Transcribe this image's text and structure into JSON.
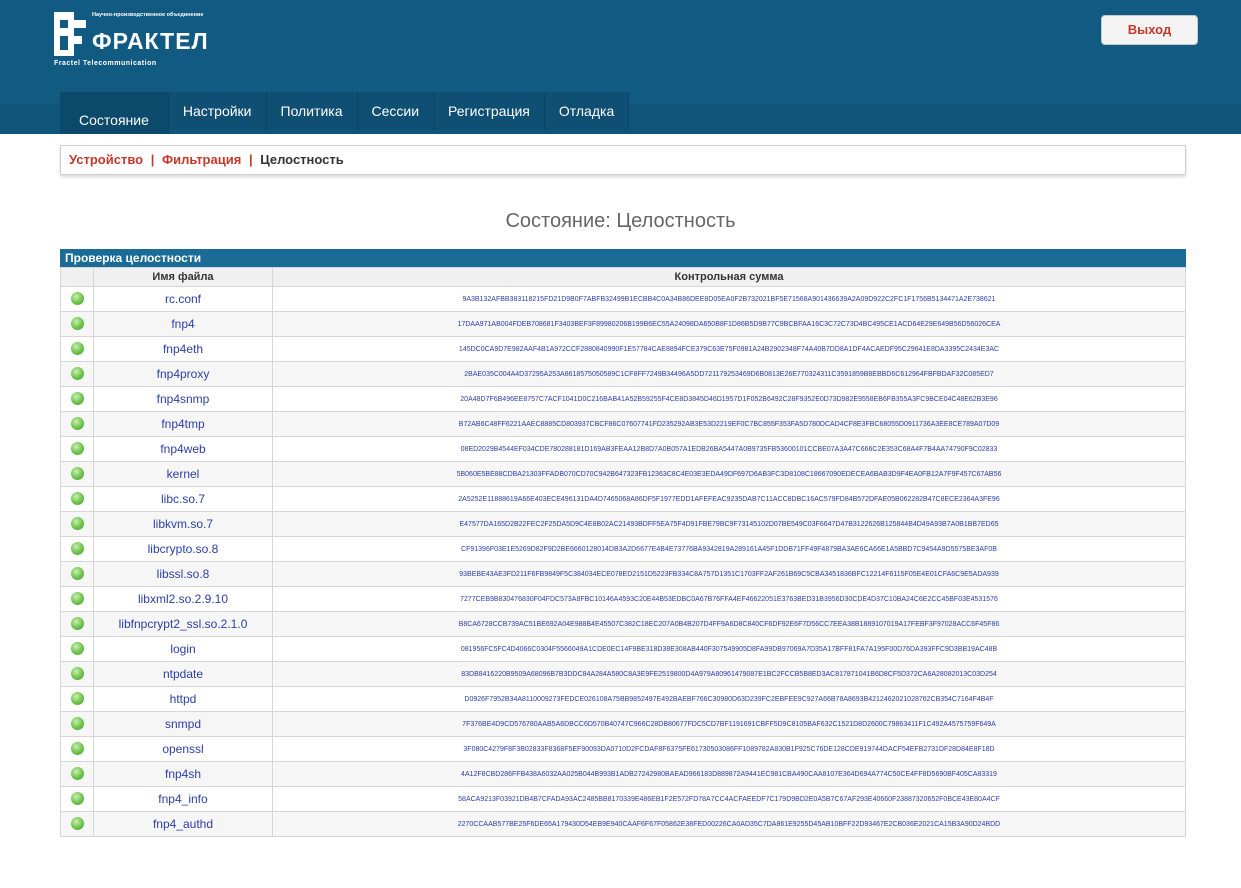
{
  "header": {
    "logo": {
      "tagline": "Научно-производственное объединение",
      "brand": "ФРАКТЕЛ",
      "subtitle": "Fractel Telecommunication"
    },
    "logout_label": "Выход"
  },
  "nav": {
    "tabs": [
      {
        "label": "Состояние",
        "active": true
      },
      {
        "label": "Настройки"
      },
      {
        "label": "Политика"
      },
      {
        "label": "Сессии"
      },
      {
        "label": "Регистрация"
      },
      {
        "label": "Отладка"
      }
    ]
  },
  "subnav": {
    "items": [
      {
        "label": "Устройство"
      },
      {
        "label": "Фильтрация"
      },
      {
        "label": "Целостность",
        "current": true
      }
    ],
    "separator": "|"
  },
  "page_title": "Состояние: Целостность",
  "panel": {
    "title": "Проверка целостности",
    "columns": [
      "",
      "Имя файла",
      "Контрольная сумма"
    ],
    "status_icon": "green-dot-icon",
    "rows": [
      {
        "file": "rc.conf",
        "checksum": "9A3B132AFBB383118215FD21D9B0F7ABFB32499B1ECBB4C0A34B86DEE8D05EA0F2B732021BF5E71568A901436639A2A09D922C2FC1F1756B5134471A2E738621"
      },
      {
        "file": "fnp4",
        "checksum": "17DAA971AB004FDEB708681F3403BEF3F89980206B199B6EC55A24098DA650B8F1D86B5D9B77C9BCBFAA16C3C72C73D4BC495CE1ACD64E29E649B56D56026CEA"
      },
      {
        "file": "fnp4eth",
        "checksum": "145DC0CA9D7E982AAF4B1A972CCF2880840990F1E57784CAE8894FCE379C63E75F0981A24B2902348F74A40B7DD8A1DF4ACAEDF95C29641E8DA3395C2434E3AC"
      },
      {
        "file": "fnp4proxy",
        "checksum": "2BAE035C004A4D37295A253A8618575050589C1CF8FF7249B34496A5DD721179253469D6B0813E26E770324311C3591859B8EBBD6C612964FBFBDAF32C085ED7"
      },
      {
        "file": "fnp4snmp",
        "checksum": "20A48D7F6B496EE8757C7ACF1041D0C216BAB41A52B59255F4CE8D3845D46D1957D1F052B6492C28F9352E0D73D982E9558EB6FB355A3FC9BCE04C48E62B3E96"
      },
      {
        "file": "fnp4tmp",
        "checksum": "B72AB6C48FF6221AAEC8885CD803937CBCF86C07607741FD235292AB3E53D2219EF0C7BC855F353FA5D780DCAD4CF8E3FBC68055D0911736A3EE8CE789A07D09"
      },
      {
        "file": "fnp4web",
        "checksum": "08ED2029B4544EF034CDE780288181D169AB3FEAA12B8D7A0B057A1EDB26BA5447A0B9735FB53600101CCBE07A3A47C666C2E353C68A4F7B4AA74790F9C02833"
      },
      {
        "file": "kernel",
        "checksum": "5B060E5BE88CDBA21303FFADB070CD70C942B647323FB12363C8C4E03E3EDA49DF697D6AB3FC3D8108C18667090EDECEA6BAB3D9F4EA0FB12A7F9F457C67AB56"
      },
      {
        "file": "libc.so.7",
        "checksum": "2A5252E11888619A66E403ECE496131DA4D7465068A86DF5F1977EDD1AFEFEAC9235DAB7C11ACC8DBC16AC579FD84B572DFAE05B062282B47C8ECE2364A3FE96"
      },
      {
        "file": "libkvm.so.7",
        "checksum": "E47577DA165D2B22FEC2F25DA5D9C4E8B02AC21493BDFF5EA75F4D91FBE79BC9F73145102D07BE549C03F6647D47B3122626B125844B4D49A93B7A0B1BB7ED65"
      },
      {
        "file": "libcrypto.so.8",
        "checksum": "CF91396F03E1E5269D82F9D2BE6660128014DB3A2D6677E4B4E73776BA9342819A289161A45F1DDB71FF49F4879BA3AE6CA66E1A5BBD7C9454A9D5575BE3AF0B"
      },
      {
        "file": "libssl.so.8",
        "checksum": "93BEBE43AE3FD211F6FB9849F5C384034ECE078ED2151D5223FB334C8A757D1351C1703FF2AF261B69C5CBA3451836BFC12214F6115F05E4E01CFA6C9E5ADA939"
      },
      {
        "file": "libxml2.so.2.9.10",
        "checksum": "7277CEB9B830476830F04FDC573A8FBC10146A4593C20E44B53EDBC0A67B76FFA4EF46622051E3763BED31B3956D30CDE4D37C10BA24C6E2CC45BF03E4531576"
      },
      {
        "file": "libfnpcrypt2_ssl.so.2.1.0",
        "checksum": "B8CA6728CCB739AC51BE692A04E988B4E45507C382C18EC207A0B4B207D4FF9A6D8C840CF6DF92E6F7D56CC7EEA38B1889107019A17FEBF3F97028ACC6F45F86"
      },
      {
        "file": "login",
        "checksum": "081956FC5FC4D4066C0304F5566049A1CDE0EC14F9BE318D38E308AB440F307549905D8FA99DB97069A7D35A17BFF81FA7A195F00D76DA393FFC9D3BB19AC48B"
      },
      {
        "file": "ntpdate",
        "checksum": "83DB8416220B9509A68096B7B3DDC84A284A580C8A3E9FE2519800D4A979A80961479087E1BC2FCCB5B8ED3AC817871041B6D8CF5D372CA6A28082013C03D254"
      },
      {
        "file": "httpd",
        "checksum": "D0926F7952B34A8110009273FEDCE026108A75BB9852497E492BAEBF766C30980D63D239FC2EBFEE9C927A66B78A8693B4212462021028762CB354C7164F4B4F"
      },
      {
        "file": "snmpd",
        "checksum": "7F376BE4D9CD576780AAB5A6DBCC6D570B40747C966C28DB80677FDC5CD7BF1191691CBFF5D9C8105BAF632C1521D8D2600C79863411F1C492A4575759F649A"
      },
      {
        "file": "openssl",
        "checksum": "3F080C4279F8F3B02833F8368F5EF90093DA0710D2FCDAF8F6375FE61730503086FF1089782A830B1F925C76DE128CDE919744DACF54EFB2731DF28D84E8F18D"
      },
      {
        "file": "fnp4sh",
        "checksum": "4A12F8CBD286FFB438A6032AA025B044B993B1ADB27242980BAEAD966183D889872A9441EC981CBA490CAA8107E364D694A774C50CE4FF8D5690BF405CA83319"
      },
      {
        "file": "fnp4_info",
        "checksum": "58ACA9213F03921DB4B7CFADA93AC2485BB8170339E486EB1F2E572FD78A7CC4ACFAEEDF7C179D9BD2E0A5B7C67AF293E40660F23887320652F0BCE43E80A4CF"
      },
      {
        "file": "fnp4_authd",
        "checksum": "2270CCAAB577BE25F6DE65A179430D54EB9E940CAAF6F67F05862E38FED00226CA0AD35C7DA861E9255D45AB10BFF22D93467E2CB036E2021CA15B3A90D24BDD"
      }
    ]
  }
}
